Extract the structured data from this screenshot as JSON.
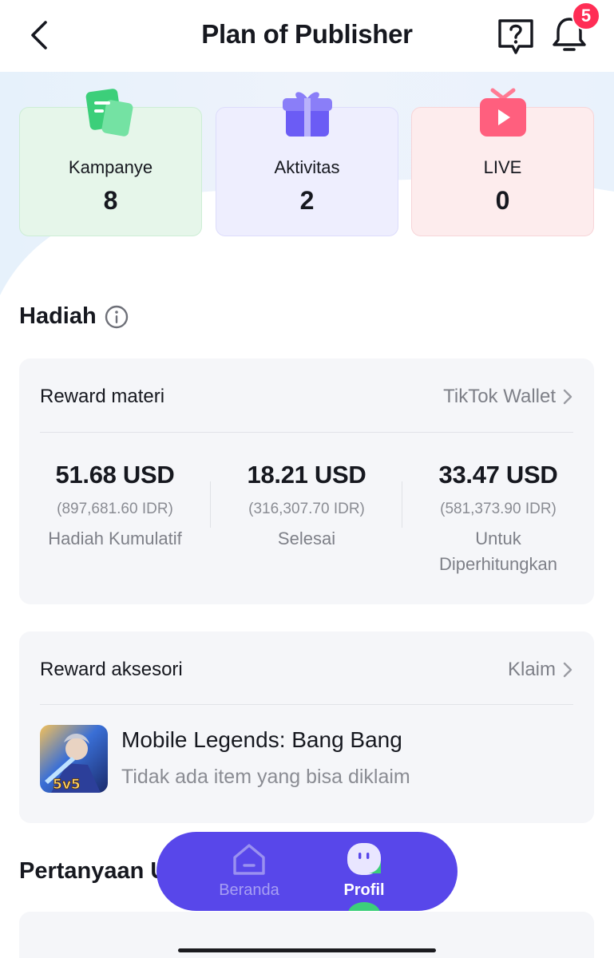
{
  "header": {
    "title": "Plan of Publisher",
    "notification_count": "5"
  },
  "stats": [
    {
      "label": "Kampanye",
      "value": "8",
      "icon": "campaign-icon",
      "color": "#3ccf7a"
    },
    {
      "label": "Aktivitas",
      "value": "2",
      "icon": "gift-icon",
      "color": "#6b5cf5"
    },
    {
      "label": "LIVE",
      "value": "0",
      "icon": "live-tv-icon",
      "color": "#ff5f7e"
    }
  ],
  "rewards_section": {
    "title": "Hadiah"
  },
  "material_reward": {
    "title": "Reward materi",
    "link": "TikTok Wallet",
    "columns": [
      {
        "usd": "51.68 USD",
        "idr": "(897,681.60 IDR)",
        "caption": "Hadiah Kumulatif"
      },
      {
        "usd": "18.21 USD",
        "idr": "(316,307.70 IDR)",
        "caption": "Selesai"
      },
      {
        "usd": "33.47 USD",
        "idr": "(581,373.90 IDR)",
        "caption": "Untuk Diperhitungkan"
      }
    ]
  },
  "accessory_reward": {
    "title": "Reward aksesori",
    "link": "Klaim",
    "game_name": "Mobile Legends: Bang Bang",
    "game_status": "Tidak ada item yang bisa diklaim",
    "game_badge": "5v5"
  },
  "faq_section": {
    "title": "Pertanyaan U"
  },
  "tabbar": {
    "items": [
      {
        "label": "Beranda",
        "active": false
      },
      {
        "label": "Profil",
        "active": true
      }
    ],
    "background": "#5847ea"
  }
}
